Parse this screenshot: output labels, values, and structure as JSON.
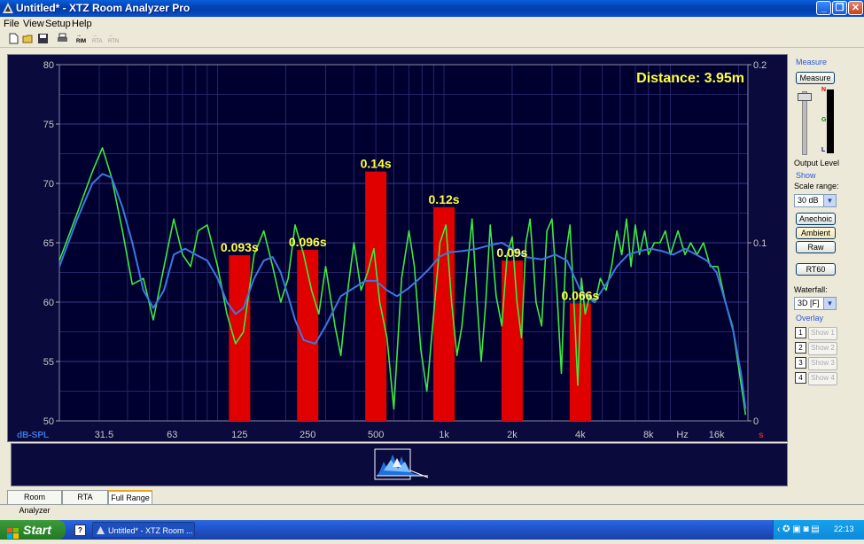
{
  "window": {
    "title": "Untitled* - XTZ Room Analyzer Pro"
  },
  "menu": [
    "File",
    "View",
    "Setup",
    "Help"
  ],
  "toolbar": {
    "rim": "RIM",
    "rta": "RTA",
    "rtn": "RTN"
  },
  "chart_data": {
    "type": "line+bar",
    "annotation": "Distance: 3.95m",
    "ylabel_left": "dB-SPL",
    "xunit": "Hz",
    "yleft_ticks": [
      "80",
      "75",
      "70",
      "65",
      "60",
      "55",
      "50"
    ],
    "yleft_range": [
      50,
      80
    ],
    "yright_ticks": [
      "0.2",
      "0.1",
      "0"
    ],
    "yright_unit": "s",
    "yright_range": [
      0,
      0.2
    ],
    "xticks": [
      {
        "f": 31.5,
        "label": "31.5"
      },
      {
        "f": 63,
        "label": "63"
      },
      {
        "f": 125,
        "label": "125"
      },
      {
        "f": 250,
        "label": "250"
      },
      {
        "f": 500,
        "label": "500"
      },
      {
        "f": 1000,
        "label": "1k"
      },
      {
        "f": 2000,
        "label": "2k"
      },
      {
        "f": 4000,
        "label": "4k"
      },
      {
        "f": 8000,
        "label": "8k"
      },
      {
        "f": 11300,
        "label": "Hz"
      },
      {
        "f": 16000,
        "label": "16k"
      }
    ],
    "x_range": [
      20,
      22000
    ],
    "rt60_bars": [
      {
        "f": 125,
        "value": 0.093,
        "label": "0.093s"
      },
      {
        "f": 250,
        "value": 0.096,
        "label": "0.096s"
      },
      {
        "f": 500,
        "value": 0.14,
        "label": "0.14s"
      },
      {
        "f": 1000,
        "value": 0.12,
        "label": "0.12s"
      },
      {
        "f": 2000,
        "value": 0.09,
        "label": "0.09s"
      },
      {
        "f": 4000,
        "value": 0.066,
        "label": "0.066s"
      }
    ],
    "series": [
      {
        "color": "#3ee83e",
        "points": [
          [
            20,
            63.5
          ],
          [
            24,
            67.5
          ],
          [
            28,
            71
          ],
          [
            31,
            73
          ],
          [
            34,
            70.5
          ],
          [
            38,
            66
          ],
          [
            42,
            61.5
          ],
          [
            47,
            62
          ],
          [
            52,
            58.5
          ],
          [
            58,
            63
          ],
          [
            64,
            67
          ],
          [
            70,
            64
          ],
          [
            76,
            63
          ],
          [
            82,
            66
          ],
          [
            90,
            66.5
          ],
          [
            100,
            63
          ],
          [
            110,
            59
          ],
          [
            120,
            56.5
          ],
          [
            130,
            57.5
          ],
          [
            145,
            64
          ],
          [
            160,
            66
          ],
          [
            175,
            63
          ],
          [
            190,
            60
          ],
          [
            205,
            62
          ],
          [
            220,
            66.5
          ],
          [
            240,
            64
          ],
          [
            260,
            61
          ],
          [
            280,
            59
          ],
          [
            300,
            63
          ],
          [
            330,
            58
          ],
          [
            350,
            55.5
          ],
          [
            370,
            60
          ],
          [
            400,
            65
          ],
          [
            430,
            61
          ],
          [
            460,
            62.5
          ],
          [
            490,
            64.5
          ],
          [
            520,
            60
          ],
          [
            560,
            57
          ],
          [
            600,
            51
          ],
          [
            650,
            62
          ],
          [
            700,
            66
          ],
          [
            740,
            63
          ],
          [
            790,
            56
          ],
          [
            840,
            52.5
          ],
          [
            900,
            59
          ],
          [
            960,
            65
          ],
          [
            1020,
            66.5
          ],
          [
            1080,
            60
          ],
          [
            1140,
            55.5
          ],
          [
            1200,
            58
          ],
          [
            1270,
            63
          ],
          [
            1330,
            67
          ],
          [
            1400,
            60
          ],
          [
            1460,
            55
          ],
          [
            1530,
            60
          ],
          [
            1600,
            66.5
          ],
          [
            1700,
            60.5
          ],
          [
            1800,
            58
          ],
          [
            1900,
            64
          ],
          [
            2000,
            65.5
          ],
          [
            2100,
            60
          ],
          [
            2200,
            57
          ],
          [
            2300,
            65
          ],
          [
            2400,
            67
          ],
          [
            2550,
            60
          ],
          [
            2700,
            58
          ],
          [
            2850,
            66
          ],
          [
            3000,
            67
          ],
          [
            3150,
            61
          ],
          [
            3300,
            54
          ],
          [
            3450,
            64
          ],
          [
            3600,
            66.5
          ],
          [
            3750,
            60
          ],
          [
            3900,
            53
          ],
          [
            4050,
            62
          ],
          [
            4200,
            59
          ],
          [
            4400,
            60.5
          ],
          [
            4650,
            60
          ],
          [
            4900,
            62
          ],
          [
            5200,
            61
          ],
          [
            5500,
            63
          ],
          [
            5800,
            66
          ],
          [
            6100,
            64
          ],
          [
            6400,
            67
          ],
          [
            6700,
            63
          ],
          [
            7000,
            66.5
          ],
          [
            7300,
            64
          ],
          [
            7700,
            66
          ],
          [
            8000,
            64
          ],
          [
            8500,
            65
          ],
          [
            9000,
            65
          ],
          [
            9500,
            66
          ],
          [
            10000,
            64
          ],
          [
            10800,
            66
          ],
          [
            11600,
            64
          ],
          [
            12300,
            65
          ],
          [
            13100,
            64
          ],
          [
            14000,
            65
          ],
          [
            15000,
            63
          ],
          [
            16200,
            63
          ],
          [
            17500,
            60
          ],
          [
            18800,
            58
          ],
          [
            20200,
            54
          ],
          [
            21500,
            50.5
          ]
        ]
      },
      {
        "color": "#3b78e0",
        "points": [
          [
            20,
            63
          ],
          [
            24,
            67
          ],
          [
            28,
            70
          ],
          [
            31,
            70.8
          ],
          [
            34,
            70.5
          ],
          [
            38,
            68
          ],
          [
            42,
            65
          ],
          [
            47,
            61
          ],
          [
            52,
            59.5
          ],
          [
            58,
            61
          ],
          [
            64,
            64
          ],
          [
            72,
            64.5
          ],
          [
            80,
            64
          ],
          [
            90,
            63.5
          ],
          [
            100,
            62
          ],
          [
            110,
            60
          ],
          [
            120,
            59
          ],
          [
            130,
            59.5
          ],
          [
            145,
            62
          ],
          [
            160,
            63.5
          ],
          [
            175,
            63.8
          ],
          [
            190,
            62.5
          ],
          [
            205,
            60.5
          ],
          [
            220,
            58.5
          ],
          [
            240,
            56.8
          ],
          [
            270,
            56.5
          ],
          [
            300,
            58
          ],
          [
            350,
            60.5
          ],
          [
            400,
            61.2
          ],
          [
            450,
            61.8
          ],
          [
            500,
            61.8
          ],
          [
            560,
            61
          ],
          [
            620,
            60.5
          ],
          [
            700,
            61.2
          ],
          [
            780,
            62
          ],
          [
            860,
            62.8
          ],
          [
            950,
            63.8
          ],
          [
            1050,
            64.2
          ],
          [
            1200,
            64.3
          ],
          [
            1400,
            64.5
          ],
          [
            1600,
            64.8
          ],
          [
            1800,
            65
          ],
          [
            2000,
            64.5
          ],
          [
            2300,
            63.8
          ],
          [
            2700,
            63.6
          ],
          [
            3100,
            64
          ],
          [
            3500,
            63.5
          ],
          [
            4000,
            61
          ],
          [
            4600,
            60
          ],
          [
            5200,
            61.5
          ],
          [
            5800,
            63
          ],
          [
            6500,
            64
          ],
          [
            7300,
            64.3
          ],
          [
            8200,
            64.5
          ],
          [
            9200,
            64.3
          ],
          [
            10300,
            64
          ],
          [
            11600,
            64.5
          ],
          [
            13000,
            64
          ],
          [
            14500,
            63.5
          ],
          [
            16000,
            62.5
          ],
          [
            17500,
            60
          ],
          [
            19000,
            57.5
          ],
          [
            20500,
            54
          ],
          [
            21500,
            51
          ]
        ]
      }
    ]
  },
  "waterfall": {
    "label": "waterfall-thumbnail"
  },
  "side": {
    "measure_title": "Measure",
    "measure_button": "Measure",
    "meter_n": "N",
    "meter_g": "G",
    "meter_l": "L",
    "output_level": "Output Level",
    "show_title": "Show",
    "scale_range_label": "Scale range:",
    "scale_range_value": "30 dB",
    "anechoic": "Anechoic",
    "ambient": "Ambient",
    "raw": "Raw",
    "rt60": "RT60",
    "waterfall_label": "Waterfall:",
    "waterfall_value": "3D [F]",
    "overlay_title": "Overlay",
    "overlays": [
      {
        "num": "1",
        "label": "Show 1"
      },
      {
        "num": "2",
        "label": "Show 2"
      },
      {
        "num": "3",
        "label": "Show 3"
      },
      {
        "num": "4",
        "label": "Show 4"
      }
    ]
  },
  "tabs": [
    "Room Analyzer",
    "RTA",
    "Full Range"
  ],
  "taskbar": {
    "start": "Start",
    "app": "Untitled* - XTZ Room ...",
    "clock": "22:13"
  },
  "colors": {
    "bar": "#e00000",
    "grid": "#3a3a8a",
    "label": "#ffff40"
  }
}
